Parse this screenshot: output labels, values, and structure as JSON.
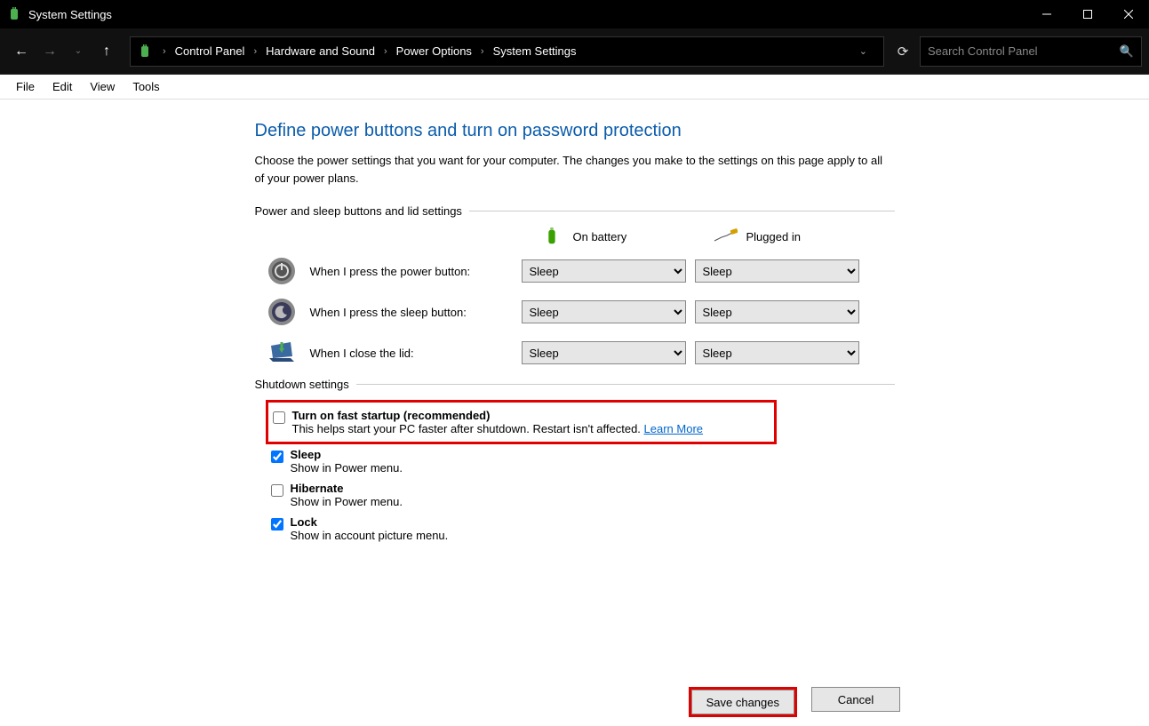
{
  "window": {
    "title": "System Settings"
  },
  "breadcrumbs": [
    "Control Panel",
    "Hardware and Sound",
    "Power Options",
    "System Settings"
  ],
  "search": {
    "placeholder": "Search Control Panel"
  },
  "menu": [
    "File",
    "Edit",
    "View",
    "Tools"
  ],
  "main": {
    "heading": "Define power buttons and turn on password protection",
    "description": "Choose the power settings that you want for your computer. The changes you make to the settings on this page apply to all of your power plans.",
    "section1_title": "Power and sleep buttons and lid settings",
    "col_battery": "On battery",
    "col_plugged": "Plugged in",
    "rows": [
      {
        "label": "When I press the power button:",
        "battery": "Sleep",
        "plugged": "Sleep"
      },
      {
        "label": "When I press the sleep button:",
        "battery": "Sleep",
        "plugged": "Sleep"
      },
      {
        "label": "When I close the lid:",
        "battery": "Sleep",
        "plugged": "Sleep"
      }
    ],
    "section2_title": "Shutdown settings",
    "shutdown_opts": [
      {
        "title": "Turn on fast startup (recommended)",
        "desc": "This helps start your PC faster after shutdown. Restart isn't affected. ",
        "link": "Learn More",
        "checked": false
      },
      {
        "title": "Sleep",
        "desc": "Show in Power menu.",
        "checked": true
      },
      {
        "title": "Hibernate",
        "desc": "Show in Power menu.",
        "checked": false
      },
      {
        "title": "Lock",
        "desc": "Show in account picture menu.",
        "checked": true
      }
    ]
  },
  "buttons": {
    "save": "Save changes",
    "cancel": "Cancel"
  }
}
